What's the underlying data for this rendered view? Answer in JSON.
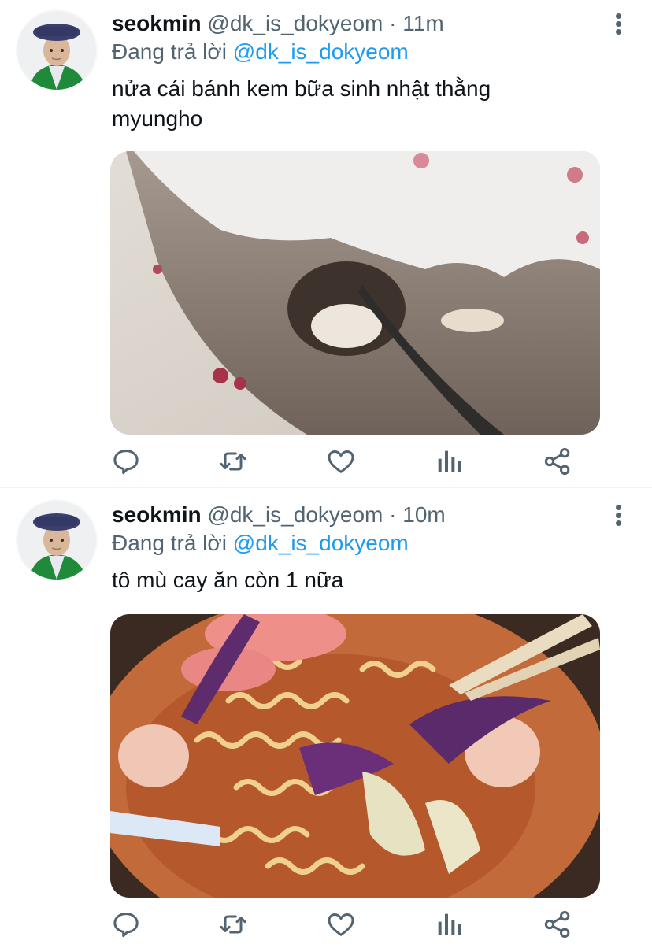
{
  "tweets": [
    {
      "author_name": "seokmin",
      "author_handle": "@dk_is_dokyeom",
      "separator": "·",
      "time": "11m",
      "replying_prefix": "Đang trả lời",
      "replying_to": "@dk_is_dokyeom",
      "text": "nửa cái bánh kem bữa sinh nhật thằng myungho",
      "media_icon": "cake-photo"
    },
    {
      "author_name": "seokmin",
      "author_handle": "@dk_is_dokyeom",
      "separator": "·",
      "time": "10m",
      "replying_prefix": "Đang trả lời",
      "replying_to": "@dk_is_dokyeom",
      "text": "tô mù cay ăn còn 1 nữa",
      "media_icon": "noodle-soup-photo"
    }
  ],
  "action_icons": [
    "reply-icon",
    "retweet-icon",
    "like-icon",
    "analytics-icon",
    "share-icon"
  ],
  "colors": {
    "text_primary": "#0f1419",
    "text_secondary": "#536471",
    "link": "#1d9bf0",
    "divider": "#eff3f4"
  }
}
